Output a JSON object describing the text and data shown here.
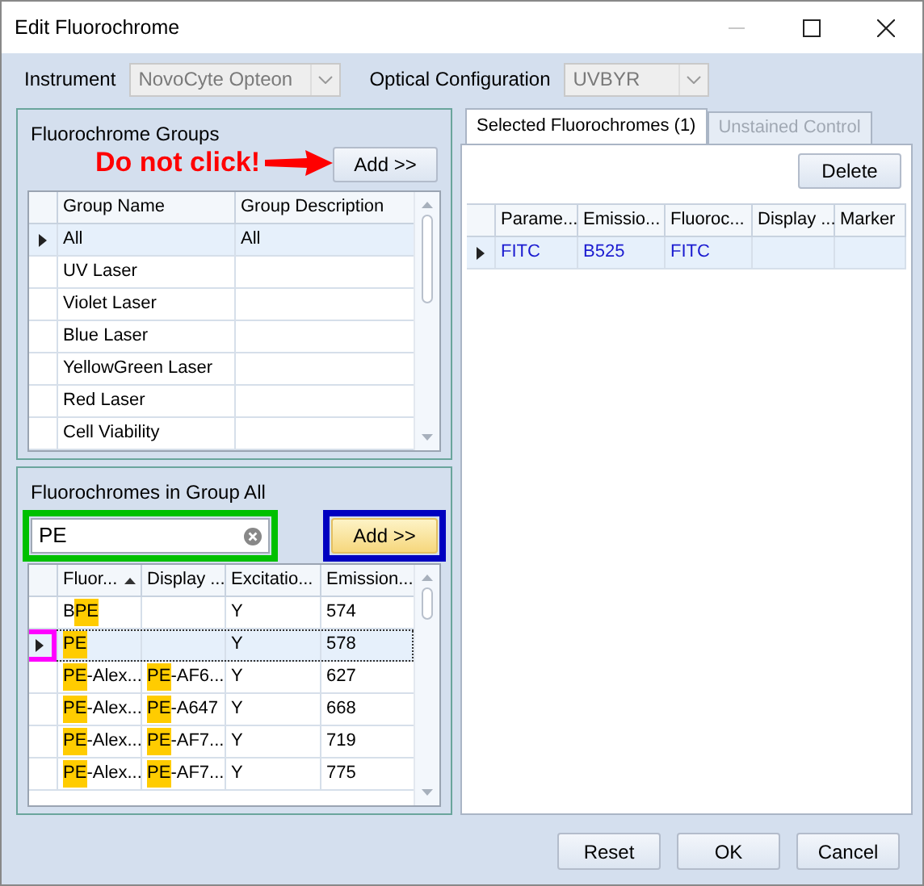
{
  "window": {
    "title": "Edit Fluorochrome",
    "minimize_disabled": true
  },
  "instrument": {
    "label": "Instrument",
    "value": "NovoCyte Opteon",
    "disabled": true
  },
  "optical": {
    "label": "Optical Configuration",
    "value": "UVBYR",
    "disabled": true
  },
  "groups": {
    "title": "Fluorochrome Groups",
    "add_button": "Add >>",
    "warning": "Do not click!",
    "columns": [
      "Group Name",
      "Group Description"
    ],
    "rows": [
      {
        "cells": [
          "All",
          "All"
        ],
        "selected": true
      },
      {
        "cells": [
          "UV Laser",
          ""
        ],
        "selected": false
      },
      {
        "cells": [
          "Violet Laser",
          ""
        ],
        "selected": false
      },
      {
        "cells": [
          "Blue Laser",
          ""
        ],
        "selected": false
      },
      {
        "cells": [
          "YellowGreen Laser",
          ""
        ],
        "selected": false
      },
      {
        "cells": [
          "Red Laser",
          ""
        ],
        "selected": false
      },
      {
        "cells": [
          "Cell Viability",
          ""
        ],
        "selected": false
      }
    ]
  },
  "fluorochromes": {
    "title": "Fluorochromes in Group All",
    "search": {
      "value": "PE",
      "highlighted": true
    },
    "add_button": {
      "label": "Add >>",
      "hover": true,
      "highlighted": true
    },
    "columns": [
      {
        "label": "Fluor...",
        "sorted": true
      },
      {
        "label": "Display ...",
        "sorted": false
      },
      {
        "label": "Excitatio...",
        "sorted": false
      },
      {
        "label": "Emission...",
        "sorted": false
      }
    ],
    "rows": [
      {
        "selected": false,
        "marker_highlighted": false,
        "cells": [
          [
            {
              "text": "B",
              "match": false
            },
            {
              "text": "PE",
              "match": true
            }
          ],
          [],
          [
            {
              "text": "Y",
              "match": false
            }
          ],
          [
            {
              "text": "574",
              "match": false
            }
          ]
        ]
      },
      {
        "selected": true,
        "marker_highlighted": true,
        "cells": [
          [
            {
              "text": "PE",
              "match": true
            }
          ],
          [],
          [
            {
              "text": "Y",
              "match": false
            }
          ],
          [
            {
              "text": "578",
              "match": false
            }
          ]
        ]
      },
      {
        "selected": false,
        "marker_highlighted": false,
        "cells": [
          [
            {
              "text": "PE",
              "match": true
            },
            {
              "text": "-Alex...",
              "match": false
            }
          ],
          [
            {
              "text": "PE",
              "match": true
            },
            {
              "text": "-AF6...",
              "match": false
            }
          ],
          [
            {
              "text": "Y",
              "match": false
            }
          ],
          [
            {
              "text": "627",
              "match": false
            }
          ]
        ]
      },
      {
        "selected": false,
        "marker_highlighted": false,
        "cells": [
          [
            {
              "text": "PE",
              "match": true
            },
            {
              "text": "-Alex...",
              "match": false
            }
          ],
          [
            {
              "text": "PE",
              "match": true
            },
            {
              "text": "-A647",
              "match": false
            }
          ],
          [
            {
              "text": "Y",
              "match": false
            }
          ],
          [
            {
              "text": "668",
              "match": false
            }
          ]
        ]
      },
      {
        "selected": false,
        "marker_highlighted": false,
        "cells": [
          [
            {
              "text": "PE",
              "match": true
            },
            {
              "text": "-Alex...",
              "match": false
            }
          ],
          [
            {
              "text": "PE",
              "match": true
            },
            {
              "text": "-AF7...",
              "match": false
            }
          ],
          [
            {
              "text": "Y",
              "match": false
            }
          ],
          [
            {
              "text": "719",
              "match": false
            }
          ]
        ]
      },
      {
        "selected": false,
        "marker_highlighted": false,
        "cells": [
          [
            {
              "text": "PE",
              "match": true
            },
            {
              "text": "-Alex...",
              "match": false
            }
          ],
          [
            {
              "text": "PE",
              "match": true
            },
            {
              "text": "-AF7...",
              "match": false
            }
          ],
          [
            {
              "text": "Y",
              "match": false
            }
          ],
          [
            {
              "text": "775",
              "match": false
            }
          ]
        ]
      }
    ]
  },
  "tabs": [
    {
      "label": "Selected Fluorochromes (1)",
      "selected": true,
      "disabled": false
    },
    {
      "label": "Unstained Control",
      "selected": false,
      "disabled": true
    }
  ],
  "selected_panel": {
    "delete_button": "Delete",
    "columns": [
      "Parame...",
      "Emissio...",
      "Fluoroc...",
      "Display ...",
      "Marker"
    ],
    "rows": [
      {
        "cells": [
          "FITC",
          "B525",
          "FITC",
          "",
          ""
        ],
        "selected": true
      }
    ]
  },
  "buttons": [
    "Reset",
    "OK",
    "Cancel"
  ]
}
